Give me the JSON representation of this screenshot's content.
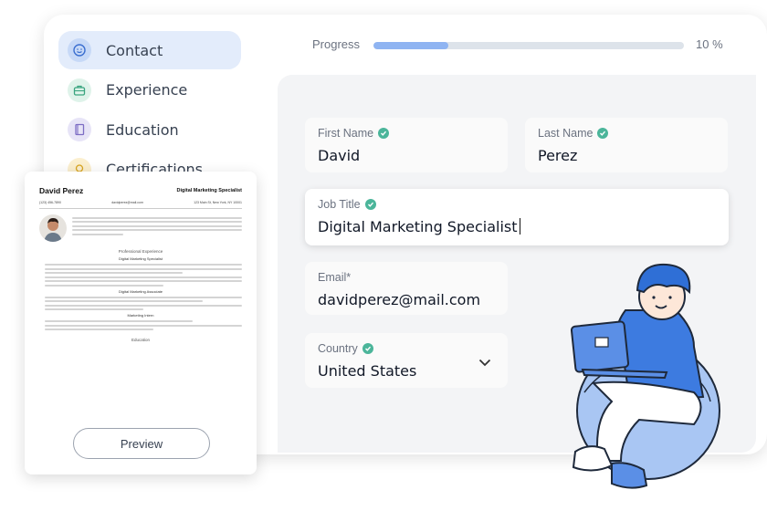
{
  "sidebar": {
    "items": [
      {
        "label": "Contact",
        "icon": "smile-icon",
        "icon_bg": "#c7d9f7",
        "active": true
      },
      {
        "label": "Experience",
        "icon": "briefcase-icon",
        "icon_bg": "#dff3ea"
      },
      {
        "label": "Education",
        "icon": "book-icon",
        "icon_bg": "#e7e4f7"
      },
      {
        "label": "Certifications",
        "icon": "badge-icon",
        "icon_bg": "#fbefcf"
      }
    ]
  },
  "progress": {
    "label": "Progress",
    "value": "10 %",
    "fraction": 0.24,
    "color": "#8fb4f2"
  },
  "form": {
    "first_name": {
      "label": "First Name",
      "value": "David"
    },
    "last_name": {
      "label": "Last Name",
      "value": "Perez"
    },
    "job_title": {
      "label": "Job Title",
      "value": "Digital Marketing Specialist"
    },
    "email": {
      "label": "Email*",
      "value": "davidperez@mail.com"
    },
    "country": {
      "label": "Country",
      "value": "United States"
    }
  },
  "resume": {
    "name": "David Perez",
    "title": "Digital Marketing Specialist",
    "phone": "(123) 456-7890",
    "email": "davidperez@mail.com",
    "address": "123 Main St, New York, NY 10001",
    "section_experience": "Professional Experience",
    "role_1": "Digital Marketing Specialist",
    "role_2": "Digital Marketing Associate",
    "role_3": "Marketing Intern",
    "section_education": "Education",
    "preview_label": "Preview"
  },
  "colors": {
    "accent": "#4bb59a",
    "active_bg": "#e3ecfb",
    "form_bg": "#f3f4f6",
    "illustration_blue": "#2f6fd6"
  }
}
